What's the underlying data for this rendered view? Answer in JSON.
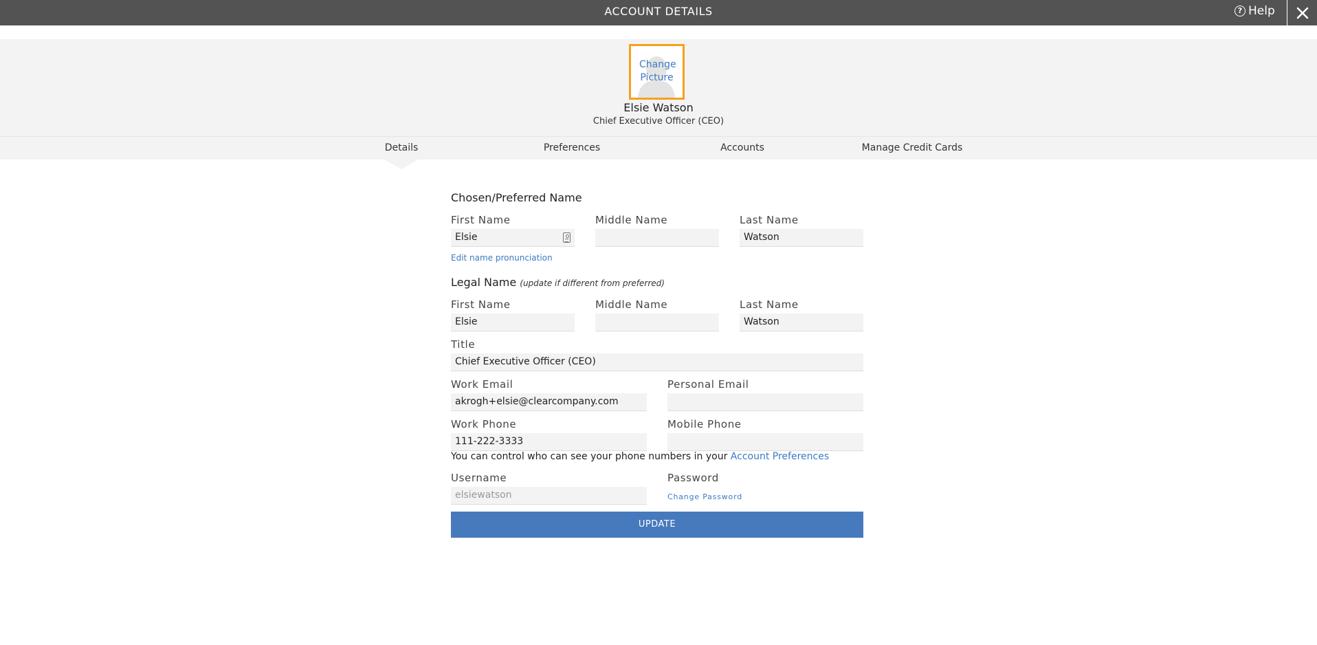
{
  "window": {
    "title": "ACCOUNT DETAILS",
    "help_label": "Help"
  },
  "profile": {
    "change_picture": "Change Picture",
    "name": "Elsie Watson",
    "job_title": "Chief Executive Officer (CEO)"
  },
  "tabs": [
    {
      "label": "Details",
      "active": true
    },
    {
      "label": "Preferences",
      "active": false
    },
    {
      "label": "Accounts",
      "active": false
    },
    {
      "label": "Manage Credit Cards",
      "active": false
    }
  ],
  "preferred_name": {
    "heading": "Chosen/Preferred Name",
    "first_label": "First Name",
    "first_value": "Elsie",
    "middle_label": "Middle Name",
    "middle_value": "",
    "last_label": "Last Name",
    "last_value": "Watson",
    "pronunciation_link": "Edit name pronunciation"
  },
  "legal_name": {
    "heading": "Legal Name",
    "note": "(update if different from preferred)",
    "first_label": "First Name",
    "first_value": "Elsie",
    "middle_label": "Middle Name",
    "middle_value": "",
    "last_label": "Last Name",
    "last_value": "Watson"
  },
  "title_field": {
    "label": "Title",
    "value": "Chief Executive Officer (CEO)"
  },
  "email": {
    "work_label": "Work Email",
    "work_value": "akrogh+elsie@clearcompany.com",
    "personal_label": "Personal Email",
    "personal_value": ""
  },
  "phone": {
    "work_label": "Work Phone",
    "work_value": "111-222-3333",
    "mobile_label": "Mobile Phone",
    "mobile_value": "",
    "visibility_text": "You can control who can see your phone numbers in your",
    "preferences_link": "Account Preferences"
  },
  "credentials": {
    "username_label": "Username",
    "username_value": "elsiewatson",
    "password_label": "Password",
    "change_password_link": "Change Password"
  },
  "update_button": "UPDATE",
  "colors": {
    "topbar": "#535353",
    "accent_blue": "#4779bd",
    "link_blue": "#3d7ac3",
    "avatar_border": "#f5a11c",
    "panel_gray": "#f3f3f3"
  }
}
